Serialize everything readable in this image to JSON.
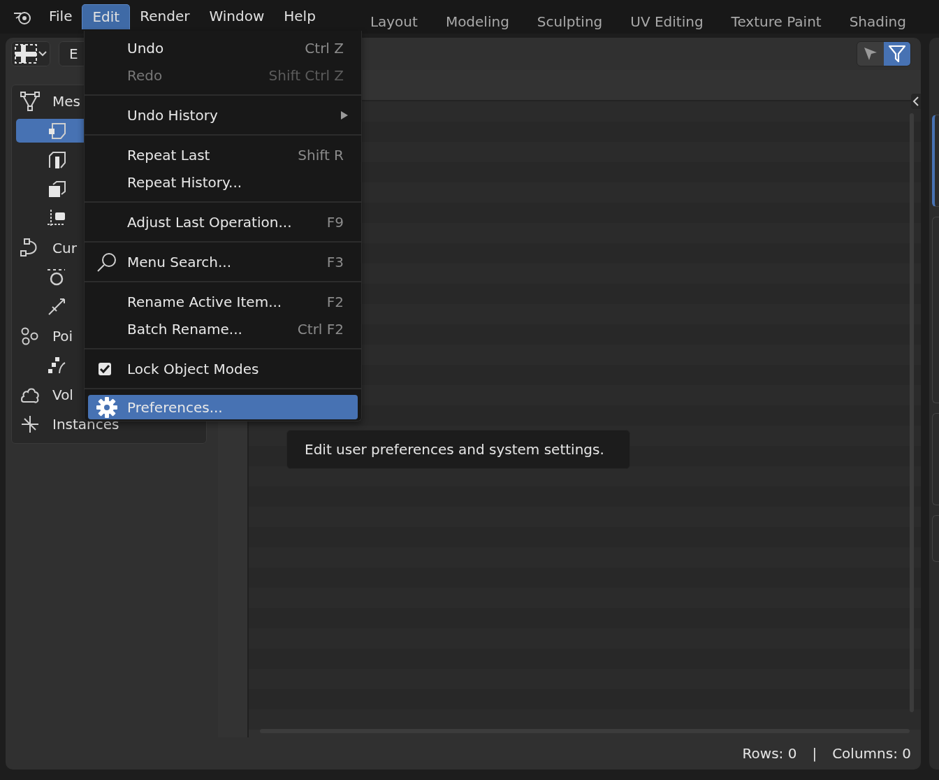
{
  "top_menu": [
    {
      "label": "File",
      "selected": false
    },
    {
      "label": "Edit",
      "selected": true
    },
    {
      "label": "Render",
      "selected": false
    },
    {
      "label": "Window",
      "selected": false
    },
    {
      "label": "Help",
      "selected": false
    }
  ],
  "workspaces": [
    {
      "label": "Layout",
      "selected": false
    },
    {
      "label": "Modeling",
      "selected": false
    },
    {
      "label": "Sculpting",
      "selected": false
    },
    {
      "label": "UV Editing",
      "selected": false
    },
    {
      "label": "Texture Paint",
      "selected": false
    },
    {
      "label": "Shading",
      "selected": false
    }
  ],
  "editor_header": {
    "dataset_button": "E",
    "filters": [
      {
        "kind": "selection",
        "on": false
      },
      {
        "kind": "filter",
        "on": true
      }
    ]
  },
  "dataset_tree": [
    {
      "label": "Mes",
      "kind": "mesh",
      "selected": false,
      "children": [
        {
          "kind": "vertex",
          "selected": true
        },
        {
          "kind": "edge",
          "selected": false
        },
        {
          "kind": "face",
          "selected": false
        },
        {
          "kind": "corner",
          "selected": false
        }
      ]
    },
    {
      "label": "Cur",
      "kind": "curve",
      "selected": false,
      "children": [
        {
          "kind": "control-point",
          "selected": false
        },
        {
          "kind": "spline",
          "selected": false
        }
      ]
    },
    {
      "label": "Poi",
      "kind": "pointcloud",
      "selected": false,
      "children": [
        {
          "kind": "points",
          "selected": false
        }
      ]
    },
    {
      "label": "Vol",
      "kind": "volume",
      "selected": false
    },
    {
      "label": "Instances",
      "kind": "instances",
      "selected": false
    }
  ],
  "status_bar": {
    "rows": "Rows: 0",
    "separator": "|",
    "columns": "Columns: 0"
  },
  "edit_menu": {
    "sections": [
      [
        {
          "label": "Undo",
          "shortcut": "Ctrl Z",
          "kind": "action",
          "disabled": false,
          "selected": false
        },
        {
          "label": "Redo",
          "shortcut": "Shift Ctrl Z",
          "kind": "action",
          "disabled": true,
          "selected": false
        }
      ],
      [
        {
          "label": "Undo History",
          "kind": "submenu",
          "disabled": false,
          "selected": false
        }
      ],
      [
        {
          "label": "Repeat Last",
          "shortcut": "Shift R",
          "kind": "action",
          "disabled": false,
          "selected": false
        },
        {
          "label": "Repeat History...",
          "kind": "action",
          "disabled": false,
          "selected": false
        }
      ],
      [
        {
          "label": "Adjust Last Operation...",
          "shortcut": "F9",
          "kind": "action",
          "disabled": false,
          "selected": false
        }
      ],
      [
        {
          "label": "Menu Search...",
          "shortcut": "F3",
          "kind": "search",
          "disabled": false,
          "selected": false
        }
      ],
      [
        {
          "label": "Rename Active Item...",
          "shortcut": "F2",
          "kind": "action",
          "disabled": false,
          "selected": false
        },
        {
          "label": "Batch Rename...",
          "shortcut": "Ctrl F2",
          "kind": "action",
          "disabled": false,
          "selected": false
        }
      ],
      [
        {
          "label": "Lock Object Modes",
          "kind": "toggle",
          "checked": true,
          "disabled": false,
          "selected": false
        }
      ],
      [
        {
          "label": "Preferences...",
          "kind": "preferences",
          "disabled": false,
          "selected": true
        }
      ]
    ]
  },
  "tooltip": "Edit user preferences and system settings."
}
